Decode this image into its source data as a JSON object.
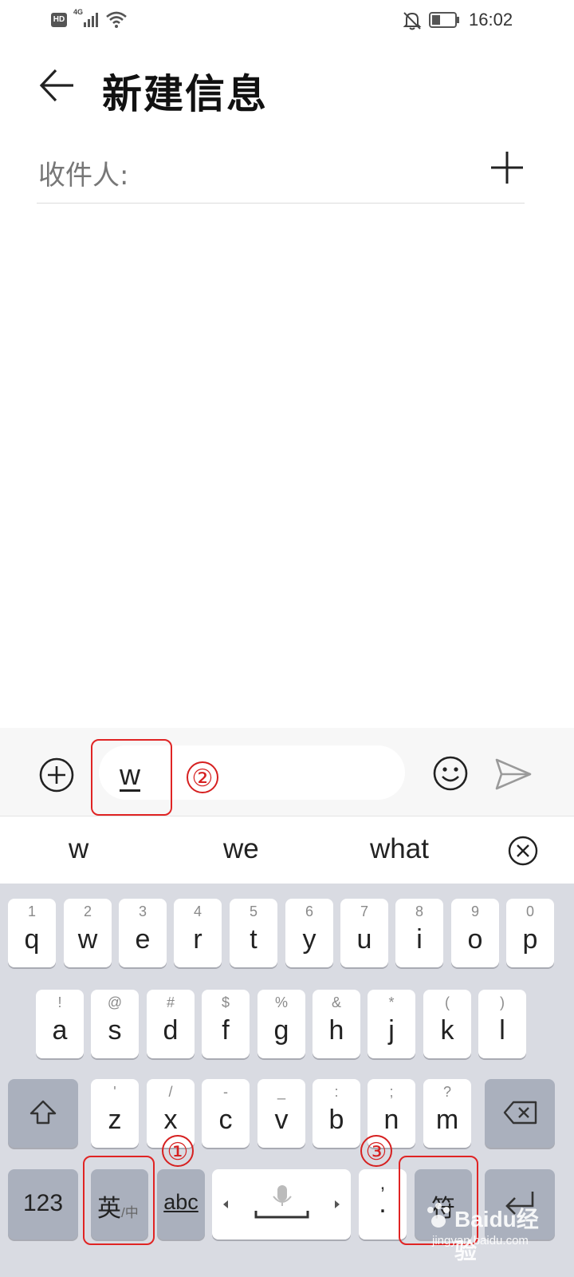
{
  "status_bar": {
    "hd": "HD",
    "network": "4G",
    "time": "16:02"
  },
  "header": {
    "title": "新建信息"
  },
  "recipients": {
    "label": "收件人:"
  },
  "compose": {
    "text": "w"
  },
  "candidates": [
    "w",
    "we",
    "what"
  ],
  "keyboard": {
    "row1": [
      {
        "main": "q",
        "sub": "1"
      },
      {
        "main": "w",
        "sub": "2"
      },
      {
        "main": "e",
        "sub": "3"
      },
      {
        "main": "r",
        "sub": "4"
      },
      {
        "main": "t",
        "sub": "5"
      },
      {
        "main": "y",
        "sub": "6"
      },
      {
        "main": "u",
        "sub": "7"
      },
      {
        "main": "i",
        "sub": "8"
      },
      {
        "main": "o",
        "sub": "9"
      },
      {
        "main": "p",
        "sub": "0"
      }
    ],
    "row2": [
      {
        "main": "a",
        "sub": "!"
      },
      {
        "main": "s",
        "sub": "@"
      },
      {
        "main": "d",
        "sub": "#"
      },
      {
        "main": "f",
        "sub": "$"
      },
      {
        "main": "g",
        "sub": "%"
      },
      {
        "main": "h",
        "sub": "&"
      },
      {
        "main": "j",
        "sub": "*"
      },
      {
        "main": "k",
        "sub": "("
      },
      {
        "main": "l",
        "sub": ")"
      }
    ],
    "row3": [
      {
        "main": "z",
        "sub": "'"
      },
      {
        "main": "x",
        "sub": "/"
      },
      {
        "main": "c",
        "sub": "-"
      },
      {
        "main": "v",
        "sub": "_"
      },
      {
        "main": "b",
        "sub": ":"
      },
      {
        "main": "n",
        "sub": ";"
      },
      {
        "main": "m",
        "sub": "?"
      }
    ],
    "num_key": "123",
    "lang_key_main": "英",
    "lang_key_sub": "/中",
    "abc_key": "abc",
    "period_main": ".",
    "period_sub": ",",
    "symbol_key": "符"
  },
  "annotations": [
    "①",
    "②",
    "③"
  ],
  "watermark": {
    "brand": "Baidu经验",
    "url": "jingyan.baidu.com"
  },
  "colors": {
    "annotation": "#e02424",
    "keyboard_bg": "#d9dbe2",
    "function_key": "#aab0bd"
  }
}
